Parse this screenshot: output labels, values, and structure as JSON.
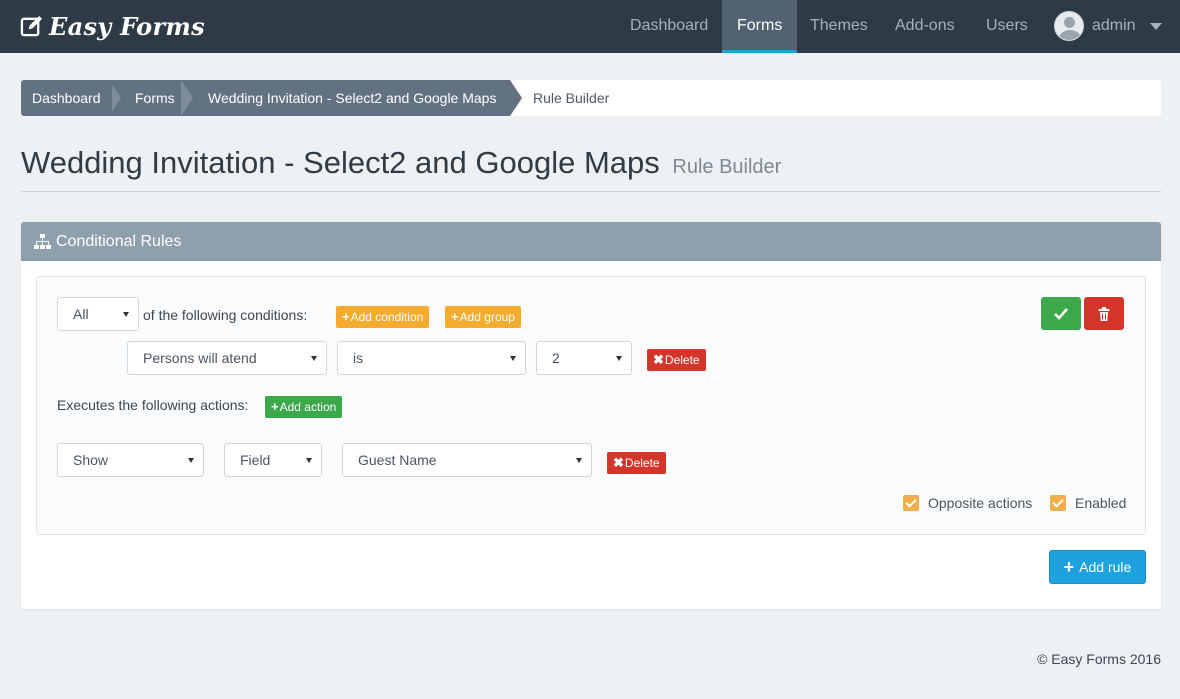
{
  "app": {
    "brand": "Easy Forms"
  },
  "nav": {
    "items": [
      {
        "label": "Dashboard"
      },
      {
        "label": "Forms"
      },
      {
        "label": "Themes"
      },
      {
        "label": "Add-ons"
      },
      {
        "label": "Users"
      }
    ],
    "active": "Forms",
    "user": "admin"
  },
  "breadcrumb": [
    "Dashboard",
    "Forms",
    "Wedding Invitation - Select2 and Google Maps",
    "Rule Builder"
  ],
  "page": {
    "title": "Wedding Invitation - Select2 and Google Maps",
    "subtitle": "Rule Builder"
  },
  "panel": {
    "title": "Conditional Rules",
    "conditions": {
      "match_select": "All",
      "match_text": "of the following conditions:",
      "add_condition": "Add condition",
      "add_group": "Add group",
      "row": {
        "field": "Persons will atend",
        "operator": "is",
        "value": "2",
        "delete": "Delete"
      }
    },
    "actions": {
      "label": "Executes the following actions:",
      "add_action": "Add action",
      "row": {
        "action": "Show",
        "target": "Field",
        "field": "Guest Name",
        "delete": "Delete"
      }
    },
    "options": {
      "opposite": "Opposite actions",
      "enabled": "Enabled"
    },
    "add_rule": "Add rule"
  },
  "footer": "© Easy Forms 2016",
  "colors": {
    "navbar": "#2e3b47",
    "accent": "#1ea2dd",
    "warning": "#f4ab2e",
    "success": "#3ba849",
    "danger": "#d3352b",
    "panel_heading": "#8fa0ad"
  }
}
